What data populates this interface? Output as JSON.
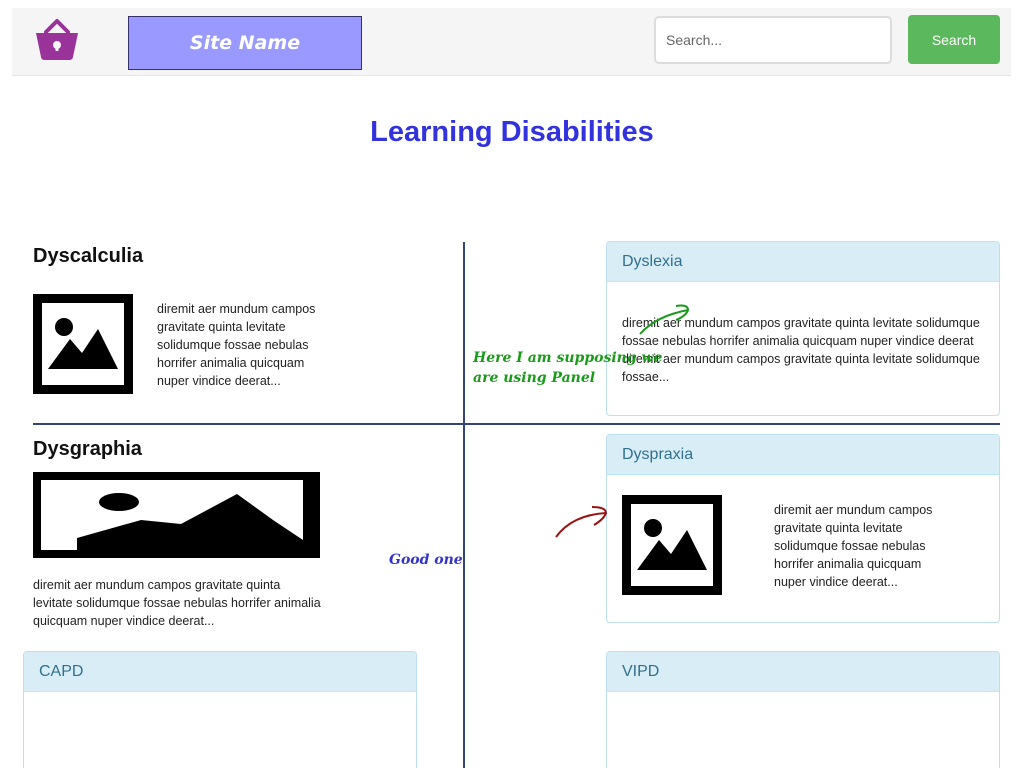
{
  "navbar": {
    "site_name": "Site Name",
    "search_placeholder": "Search...",
    "search_button": "Search",
    "logo_icon": "shopping-basket-icon",
    "logo_color": "#993399"
  },
  "page": {
    "title": "Learning Disabilities"
  },
  "sections": {
    "dyscalculia": {
      "heading": "Dyscalculia",
      "text": "diremit aer mundum campos gravitate quinta levitate solidumque fossae nebulas horrifer animalia quicquam nuper vindice deerat..."
    },
    "dysgraphia": {
      "heading": "Dysgraphia",
      "text": "diremit aer mundum campos gravitate quinta levitate solidumque fossae nebulas horrifer animalia quicquam nuper vindice deerat..."
    }
  },
  "panels": {
    "dyslexia": {
      "heading": "Dyslexia",
      "text": "diremit aer mundum campos gravitate quinta levitate solidumque fossae nebulas horrifer animalia quicquam nuper vindice deerat diremit aer mundum campos gravitate quinta levitate solidumque fossae..."
    },
    "dyspraxia": {
      "heading": "Dyspraxia",
      "text": "diremit aer mundum campos gravitate quinta levitate solidumque fossae nebulas horrifer animalia quicquam nuper vindice deerat..."
    },
    "capd": {
      "heading": "CAPD"
    },
    "vipd": {
      "heading": "VIPD"
    }
  },
  "annotations": {
    "panel_note_line1": "Here I am supposing we",
    "panel_note_line2": "are using Panel",
    "good_one": "Good one",
    "green_color": "#1a9a1a",
    "blue_color": "#3333cc",
    "red_color": "#991111"
  },
  "colors": {
    "title": "#3333dd",
    "site_name_bg": "#9999ff",
    "search_button_bg": "#5cb85c",
    "panel_heading_bg": "#d9edf7",
    "panel_heading_text": "#31708f",
    "divider": "#33447a"
  }
}
